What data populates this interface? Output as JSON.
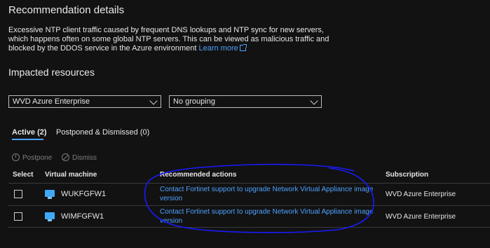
{
  "details": {
    "title": "Recommendation details",
    "description": "Excessive NTP client traffic caused by frequent DNS lookups and NTP sync for new servers, which happens often on some global NTP servers. This can be viewed as malicious traffic and blocked by the DDOS service in the Azure environment",
    "learn_more": "Learn more"
  },
  "impacted": {
    "title": "Impacted resources",
    "subscription_filter": "WVD Azure Enterprise",
    "grouping_filter": "No grouping"
  },
  "tabs": [
    {
      "label": "Active (2)",
      "active": true
    },
    {
      "label": "Postponed & Dismissed (0)",
      "active": false
    }
  ],
  "actions": {
    "postpone": "Postpone",
    "dismiss": "Dismiss"
  },
  "table": {
    "headers": {
      "select": "Select",
      "vm": "Virtual machine",
      "actions": "Recommended actions",
      "subscription": "Subscription"
    },
    "rows": [
      {
        "vm": "WUKFGFW1",
        "action": "Contact Fortinet support to upgrade Network Virtual Appliance image version",
        "subscription": "WVD Azure Enterprise"
      },
      {
        "vm": "WIMFGFW1",
        "action": "Contact Fortinet support to upgrade Network Virtual Appliance image version",
        "subscription": "WVD Azure Enterprise"
      }
    ]
  },
  "colors": {
    "background": "#121212",
    "link": "#4ea1ff",
    "annotation": "#1a1aff"
  }
}
